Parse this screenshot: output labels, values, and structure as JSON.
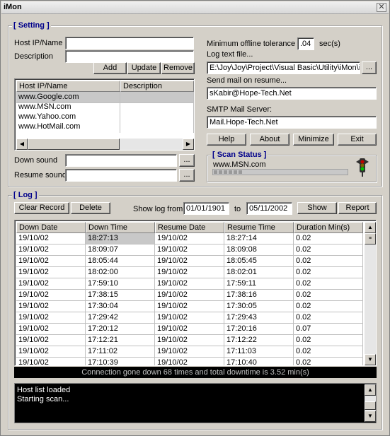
{
  "window": {
    "title": "iMon",
    "close": "✕"
  },
  "setting": {
    "group_title": "[ Setting ]",
    "host_label": "Host IP/Name",
    "desc_label": "Description",
    "host_value": "",
    "desc_value": "",
    "add": "Add",
    "update": "Update",
    "remove": "Remove",
    "columns": [
      "Host IP/Name",
      "Description"
    ],
    "hosts": [
      "www.Google.com",
      "www.MSN.com",
      "www.Yahoo.com",
      "www.HotMail.com"
    ],
    "down_sound_label": "Down sound",
    "resume_sound_label": "Resume sound",
    "browse": "...",
    "min_offline_label": "Minimum offline tolerance",
    "min_offline_value": ".04",
    "min_offline_unit": "sec(s)",
    "log_file_label": "Log text file...",
    "log_file_value": "E:\\Joy\\Joy\\Project\\Visual Basic\\Utility\\iMon\\i",
    "send_mail_label": "Send mail on resume...",
    "send_mail_value": "sKabir@Hope-Tech.Net",
    "smtp_label": "SMTP Mail Server:",
    "smtp_value": "Mail.Hope-Tech.Net",
    "help": "Help",
    "about": "About",
    "minimize": "Minimize",
    "exit": "Exit"
  },
  "scan": {
    "group_title": "[ Scan Status ]",
    "current_host": "www.MSN.com",
    "light_color": "#00c000"
  },
  "log": {
    "group_title": "[ Log ]",
    "clear": "Clear Record",
    "delete": "Delete",
    "show_from_label": "Show log from",
    "from_date": "01/01/1901",
    "to_label": "to",
    "to_date": "05/11/2002",
    "show": "Show",
    "report": "Report",
    "columns": [
      "Down Date",
      "Down Time",
      "Resume Date",
      "Resume Time",
      "Duration Min(s)"
    ],
    "rows": [
      [
        "19/10/02",
        "18:27:13",
        "19/10/02",
        "18:27:14",
        "0.02"
      ],
      [
        "19/10/02",
        "18:09:07",
        "19/10/02",
        "18:09:08",
        "0.02"
      ],
      [
        "19/10/02",
        "18:05:44",
        "19/10/02",
        "18:05:45",
        "0.02"
      ],
      [
        "19/10/02",
        "18:02:00",
        "19/10/02",
        "18:02:01",
        "0.02"
      ],
      [
        "19/10/02",
        "17:59:10",
        "19/10/02",
        "17:59:11",
        "0.02"
      ],
      [
        "19/10/02",
        "17:38:15",
        "19/10/02",
        "17:38:16",
        "0.02"
      ],
      [
        "19/10/02",
        "17:30:04",
        "19/10/02",
        "17:30:05",
        "0.02"
      ],
      [
        "19/10/02",
        "17:29:42",
        "19/10/02",
        "17:29:43",
        "0.02"
      ],
      [
        "19/10/02",
        "17:20:12",
        "19/10/02",
        "17:20:16",
        "0.07"
      ],
      [
        "19/10/02",
        "17:12:21",
        "19/10/02",
        "17:12:22",
        "0.02"
      ],
      [
        "19/10/02",
        "17:11:02",
        "19/10/02",
        "17:11:03",
        "0.02"
      ],
      [
        "19/10/02",
        "17:10:39",
        "19/10/02",
        "17:10:40",
        "0.02"
      ]
    ],
    "summary": "Connection gone down 68 times and total downtime is 3.52 min(s)",
    "console_lines": [
      "Host list loaded",
      "Starting scan..."
    ]
  }
}
